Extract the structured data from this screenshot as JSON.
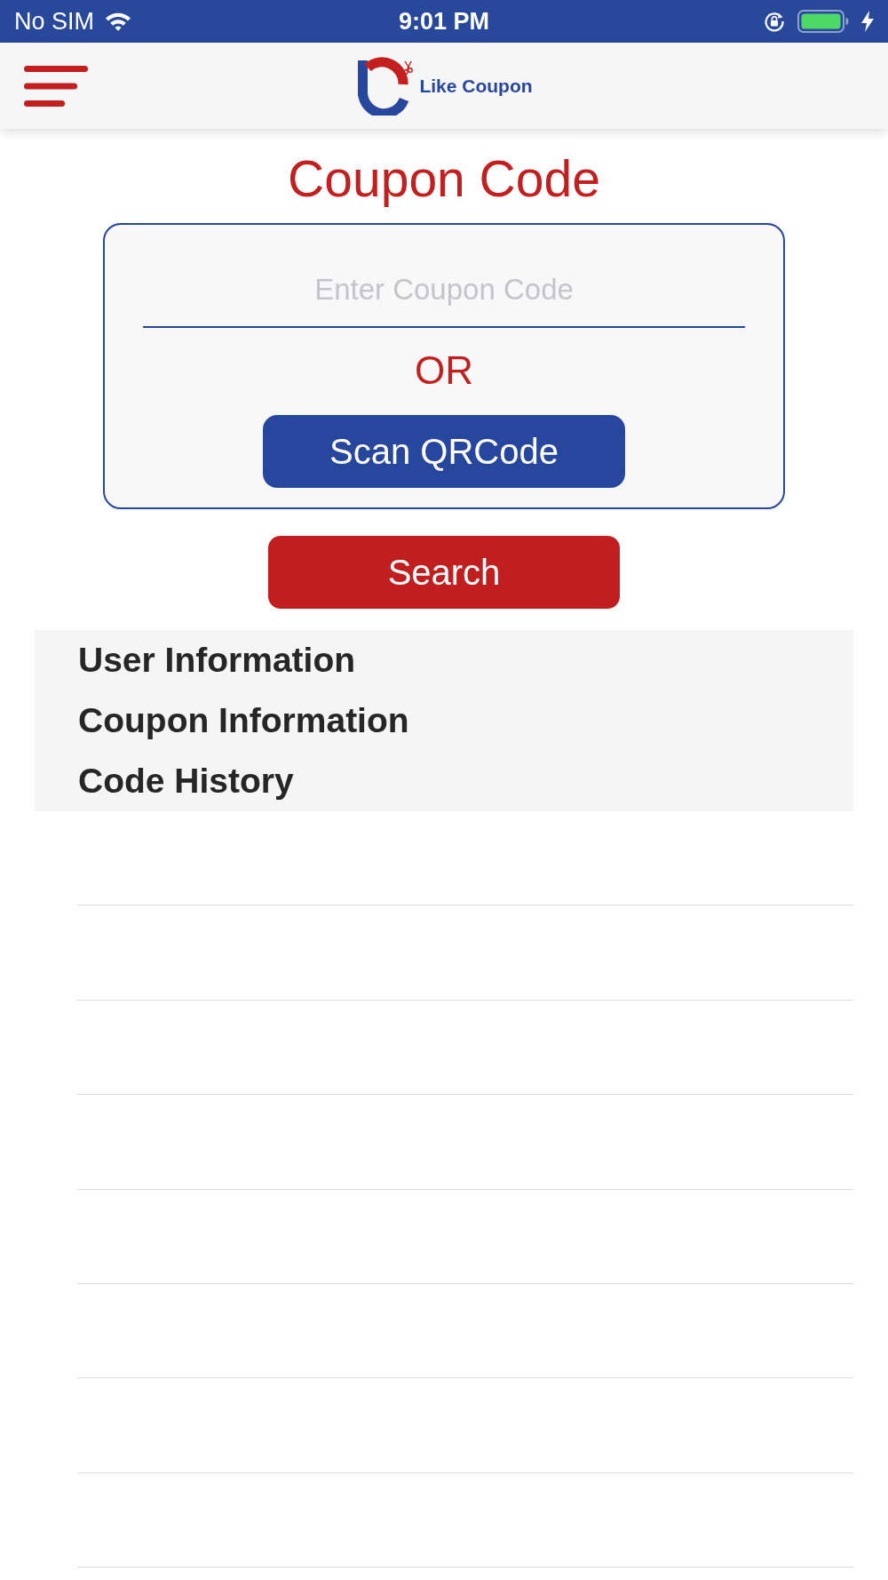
{
  "status_bar": {
    "carrier": "No SIM",
    "time": "9:01 PM"
  },
  "header": {
    "logo_text": "Like Coupon"
  },
  "title": "Coupon Code",
  "coupon_form": {
    "code_field": {
      "placeholder": "Enter Coupon Code"
    },
    "separator_text": "OR",
    "scan_button": "Scan QRCode"
  },
  "search_button": "Search",
  "sections": [
    {
      "label": "User Information"
    },
    {
      "label": "Coupon Information"
    },
    {
      "label": "Code History"
    }
  ]
}
